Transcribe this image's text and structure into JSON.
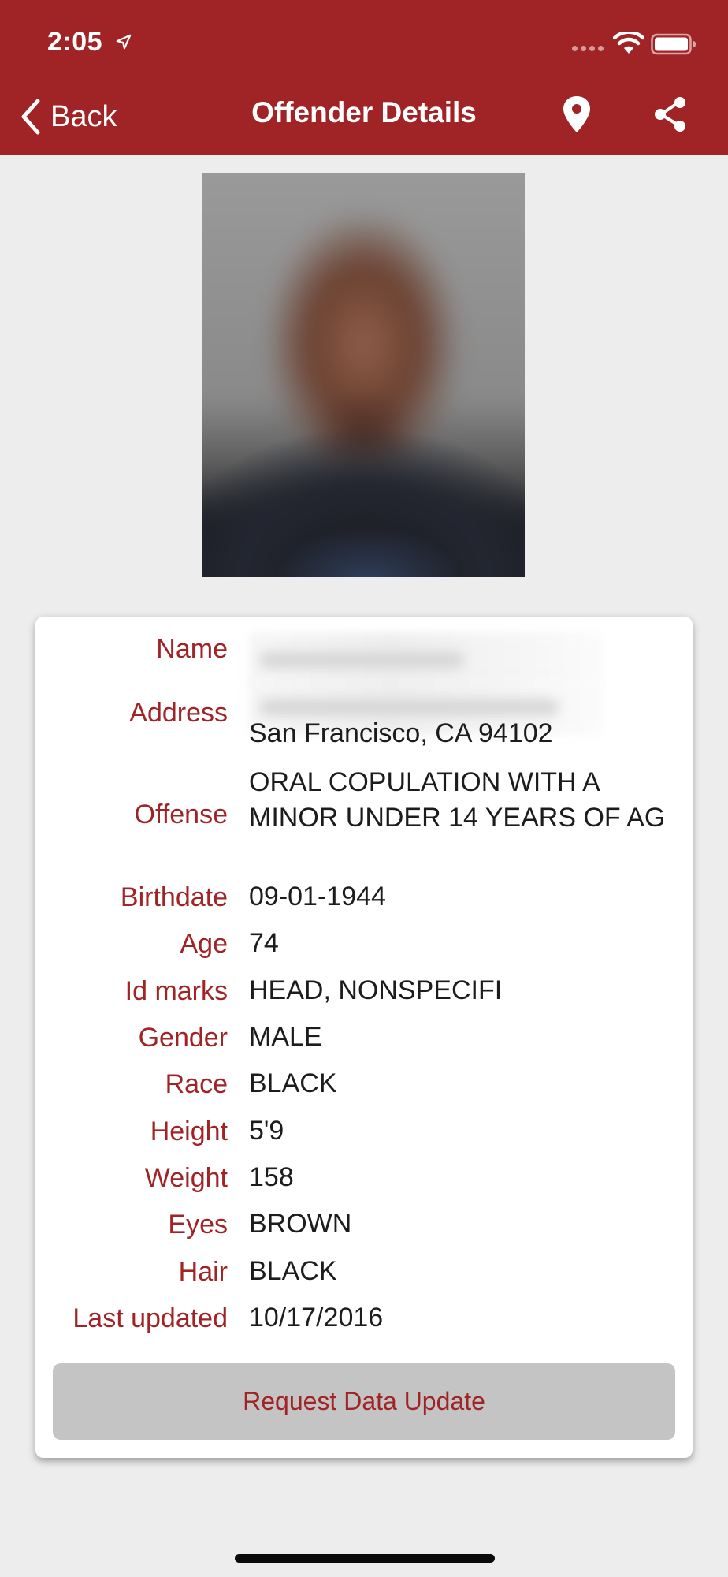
{
  "status_bar": {
    "time": "2:05"
  },
  "nav": {
    "back_label": "Back",
    "title": "Offender Details"
  },
  "details": {
    "labels": {
      "name": "Name",
      "address": "Address",
      "offense": "Offense",
      "birthdate": "Birthdate",
      "age": "Age",
      "id_marks": "Id marks",
      "gender": "Gender",
      "race": "Race",
      "height": "Height",
      "weight": "Weight",
      "eyes": "Eyes",
      "hair": "Hair",
      "last_updated": "Last updated"
    },
    "values": {
      "address_city": "San Francisco, CA 94102",
      "offense": "ORAL COPULATION WITH A MINOR UNDER 14 YEARS OF AG",
      "birthdate": "09-01-1944",
      "age": "74",
      "id_marks": "HEAD, NONSPECIFI",
      "gender": "MALE",
      "race": "BLACK",
      "height": "5'9",
      "weight": "158",
      "eyes": "BROWN",
      "hair": "BLACK",
      "last_updated": "10/17/2016"
    }
  },
  "actions": {
    "request_update_label": "Request Data Update"
  },
  "colors": {
    "brand": "#a02325",
    "background": "#ededed",
    "button": "#c4c4c4"
  },
  "icons": {
    "back": "chevron-left-icon",
    "location": "map-pin-icon",
    "share": "share-icon",
    "status_location": "location-arrow-icon",
    "wifi": "wifi-icon",
    "battery": "battery-icon"
  }
}
